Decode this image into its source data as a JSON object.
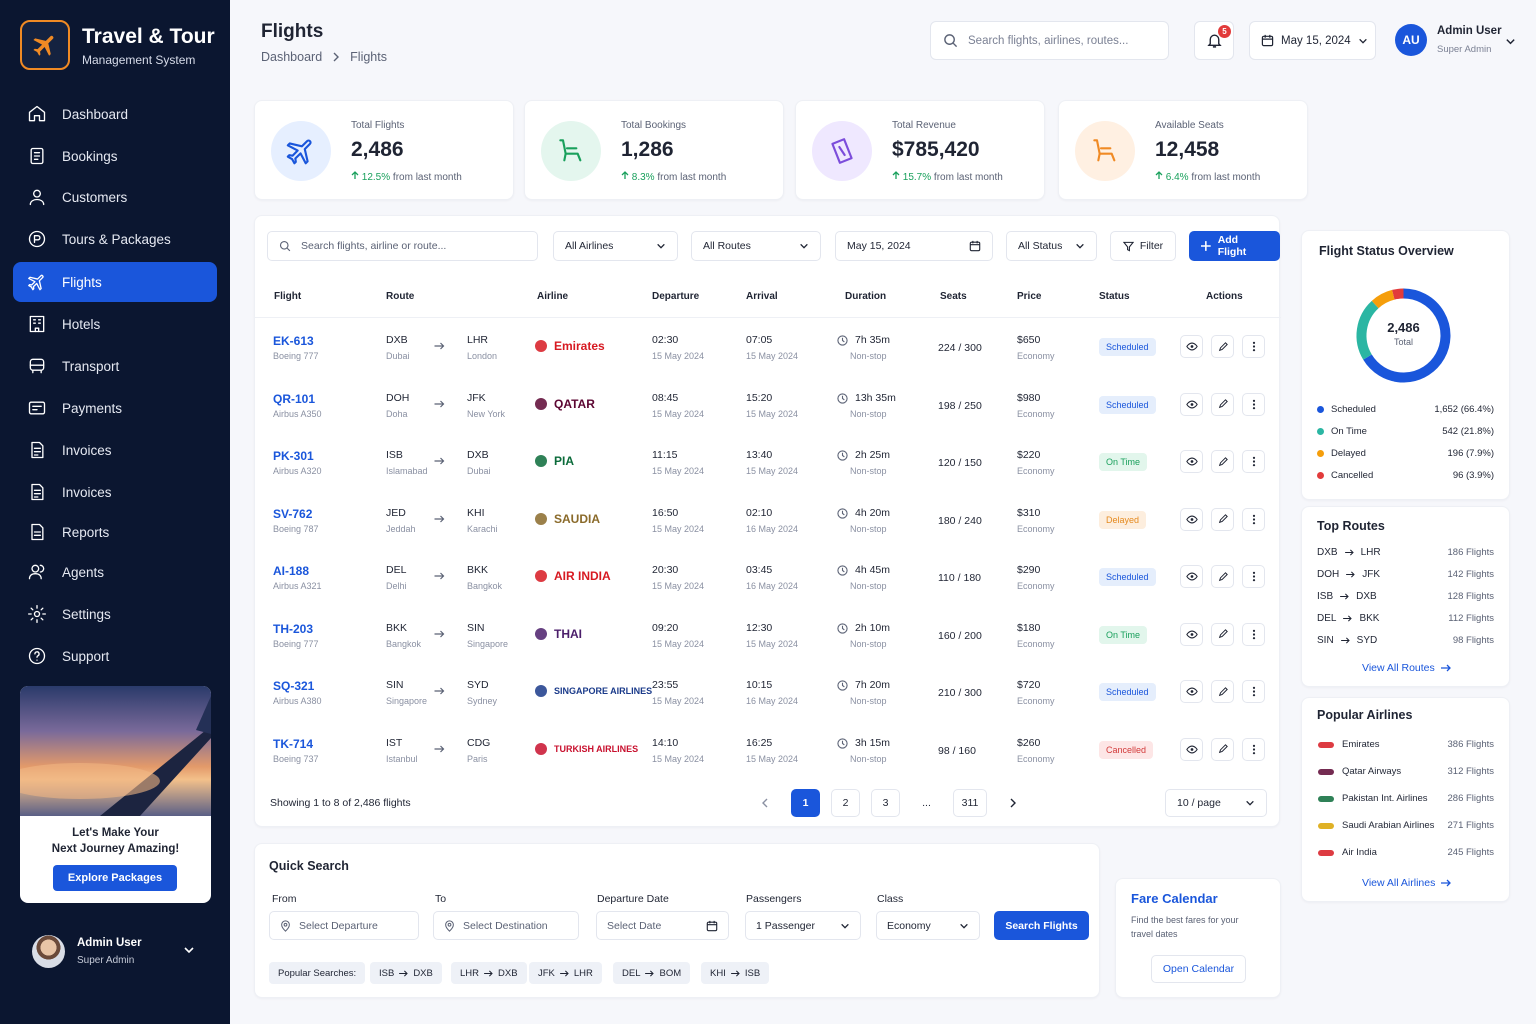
{
  "brand": {
    "name": "Travel & Tour",
    "subtitle": "Management System"
  },
  "nav": [
    "Dashboard",
    "Bookings",
    "Customers",
    "Tours & Packages",
    "Flights",
    "Hotels",
    "Transport",
    "Payments",
    "Invoices",
    "Invoices",
    "Reports",
    "Agents",
    "Settings",
    "Support"
  ],
  "promo": {
    "line1": "Let's Make Your",
    "line2": "Next Journey Amazing!",
    "button": "Explore Packages"
  },
  "sidebar_user": {
    "name": "Admin User",
    "role": "Super Admin"
  },
  "header": {
    "title": "Flights",
    "crumb_root": "Dashboard",
    "crumb_current": "Flights",
    "search_placeholder": "Search flights, airlines, routes...",
    "notifications": "5",
    "date": "May 15, 2024",
    "avatar": "AU",
    "user": "Admin User",
    "role": "Super Admin"
  },
  "stats": [
    {
      "label": "Total Flights",
      "value": "2,486",
      "pct": "12.5%",
      "note": "from last month"
    },
    {
      "label": "Total Bookings",
      "value": "1,286",
      "pct": "8.3%",
      "note": "from last month"
    },
    {
      "label": "Total Revenue",
      "value": "$785,420",
      "pct": "15.7%",
      "note": "from last month"
    },
    {
      "label": "Available Seats",
      "value": "12,458",
      "pct": "6.4%",
      "note": "from last month"
    }
  ],
  "filters": {
    "search_placeholder": "Search flights, airline or route...",
    "airlines": "All Airlines",
    "routes": "All Routes",
    "date": "May 15, 2024",
    "status": "All Status",
    "filter": "Filter",
    "add": "Add Flight"
  },
  "columns": [
    "Flight",
    "Route",
    "Airline",
    "Departure",
    "Arrival",
    "Duration",
    "Seats",
    "Price",
    "Status",
    "Actions"
  ],
  "flights": [
    {
      "code": "EK-613",
      "aircraft": "Boeing 777",
      "from": "DXB",
      "from_city": "Dubai",
      "to": "LHR",
      "to_city": "London",
      "airline": "Emirates",
      "dep": "02:30",
      "dep_date": "15 May 2024",
      "arr": "07:05",
      "arr_date": "15 May 2024",
      "dur": "7h 35m",
      "stops": "Non-stop",
      "seats": "224 / 300",
      "price": "$650",
      "cls": "Economy",
      "status": "Scheduled"
    },
    {
      "code": "QR-101",
      "aircraft": "Airbus A350",
      "from": "DOH",
      "from_city": "Doha",
      "to": "JFK",
      "to_city": "New York",
      "airline": "QATAR",
      "dep": "08:45",
      "dep_date": "15 May 2024",
      "arr": "15:20",
      "arr_date": "15 May 2024",
      "dur": "13h 35m",
      "stops": "Non-stop",
      "seats": "198 / 250",
      "price": "$980",
      "cls": "Economy",
      "status": "Scheduled"
    },
    {
      "code": "PK-301",
      "aircraft": "Airbus A320",
      "from": "ISB",
      "from_city": "Islamabad",
      "to": "DXB",
      "to_city": "Dubai",
      "airline": "PIA",
      "dep": "11:15",
      "dep_date": "15 May 2024",
      "arr": "13:40",
      "arr_date": "15 May 2024",
      "dur": "2h 25m",
      "stops": "Non-stop",
      "seats": "120 / 150",
      "price": "$220",
      "cls": "Economy",
      "status": "On Time"
    },
    {
      "code": "SV-762",
      "aircraft": "Boeing 787",
      "from": "JED",
      "from_city": "Jeddah",
      "to": "KHI",
      "to_city": "Karachi",
      "airline": "SAUDIA",
      "dep": "16:50",
      "dep_date": "15 May 2024",
      "arr": "02:10",
      "arr_date": "16 May 2024",
      "dur": "4h 20m",
      "stops": "Non-stop",
      "seats": "180 / 240",
      "price": "$310",
      "cls": "Economy",
      "status": "Delayed"
    },
    {
      "code": "AI-188",
      "aircraft": "Airbus A321",
      "from": "DEL",
      "from_city": "Delhi",
      "to": "BKK",
      "to_city": "Bangkok",
      "airline": "AIR INDIA",
      "dep": "20:30",
      "dep_date": "15 May 2024",
      "arr": "03:45",
      "arr_date": "16 May 2024",
      "dur": "4h 45m",
      "stops": "Non-stop",
      "seats": "110 / 180",
      "price": "$290",
      "cls": "Economy",
      "status": "Scheduled"
    },
    {
      "code": "TH-203",
      "aircraft": "Boeing 777",
      "from": "BKK",
      "from_city": "Bangkok",
      "to": "SIN",
      "to_city": "Singapore",
      "airline": "THAI",
      "dep": "09:20",
      "dep_date": "15 May 2024",
      "arr": "12:30",
      "arr_date": "15 May 2024",
      "dur": "2h 10m",
      "stops": "Non-stop",
      "seats": "160 / 200",
      "price": "$180",
      "cls": "Economy",
      "status": "On Time"
    },
    {
      "code": "SQ-321",
      "aircraft": "Airbus A380",
      "from": "SIN",
      "from_city": "Singapore",
      "to": "SYD",
      "to_city": "Sydney",
      "airline": "SINGAPORE AIRLINES",
      "dep": "23:55",
      "dep_date": "15 May 2024",
      "arr": "10:15",
      "arr_date": "16 May 2024",
      "dur": "7h 20m",
      "stops": "Non-stop",
      "seats": "210 / 300",
      "price": "$720",
      "cls": "Economy",
      "status": "Scheduled"
    },
    {
      "code": "TK-714",
      "aircraft": "Boeing 737",
      "from": "IST",
      "from_city": "Istanbul",
      "to": "CDG",
      "to_city": "Paris",
      "airline": "TURKISH AIRLINES",
      "dep": "14:10",
      "dep_date": "15 May 2024",
      "arr": "16:25",
      "arr_date": "15 May 2024",
      "dur": "3h 15m",
      "stops": "Non-stop",
      "seats": "98 / 160",
      "price": "$260",
      "cls": "Economy",
      "status": "Cancelled"
    }
  ],
  "pagination": {
    "showing": "Showing 1 to 8 of 2,486 flights",
    "pages": [
      "1",
      "2",
      "3",
      "...",
      "311"
    ],
    "per_page": "10 / page"
  },
  "quick_search": {
    "title": "Quick Search",
    "from_label": "From",
    "from_ph": "Select Departure",
    "to_label": "To",
    "to_ph": "Select Destination",
    "date_label": "Departure Date",
    "date_ph": "Select Date",
    "pax_label": "Passengers",
    "pax": "1 Passenger",
    "class_label": "Class",
    "class": "Economy",
    "button": "Search Flights",
    "popular_label": "Popular Searches:",
    "popular": [
      [
        "ISB",
        "DXB"
      ],
      [
        "LHR",
        "DXB"
      ],
      [
        "JFK",
        "LHR"
      ],
      [
        "DEL",
        "BOM"
      ],
      [
        "KHI",
        "ISB"
      ]
    ]
  },
  "fare": {
    "title": "Fare Calendar",
    "desc1": "Find the best fares for your",
    "desc2": "travel dates",
    "button": "Open Calendar"
  },
  "status_overview": {
    "title": "Flight Status Overview",
    "total": "2,486",
    "total_label": "Total",
    "items": [
      {
        "name": "Scheduled",
        "value": "1,652 (66.4%)",
        "share": 66.4,
        "color": "#1a56db"
      },
      {
        "name": "On Time",
        "value": "542 (21.8%)",
        "share": 21.8,
        "color": "#2bb6a3"
      },
      {
        "name": "Delayed",
        "value": "196 (7.9%)",
        "share": 7.9,
        "color": "#f59e0b"
      },
      {
        "name": "Cancelled",
        "value": "96 (3.9%)",
        "share": 3.9,
        "color": "#e23b3b"
      }
    ]
  },
  "top_routes": {
    "title": "Top Routes",
    "items": [
      [
        "DXB",
        "LHR",
        "186 Flights"
      ],
      [
        "DOH",
        "JFK",
        "142 Flights"
      ],
      [
        "ISB",
        "DXB",
        "128 Flights"
      ],
      [
        "DEL",
        "BKK",
        "112 Flights"
      ],
      [
        "SIN",
        "SYD",
        "98 Flights"
      ]
    ],
    "link": "View All Routes"
  },
  "popular_airlines": {
    "title": "Popular Airlines",
    "items": [
      [
        "Emirates",
        "386 Flights"
      ],
      [
        "Qatar Airways",
        "312 Flights"
      ],
      [
        "Pakistan Int. Airlines",
        "286 Flights"
      ],
      [
        "Saudi Arabian Airlines",
        "271 Flights"
      ],
      [
        "Air India",
        "245 Flights"
      ]
    ],
    "link": "View All Airlines"
  }
}
